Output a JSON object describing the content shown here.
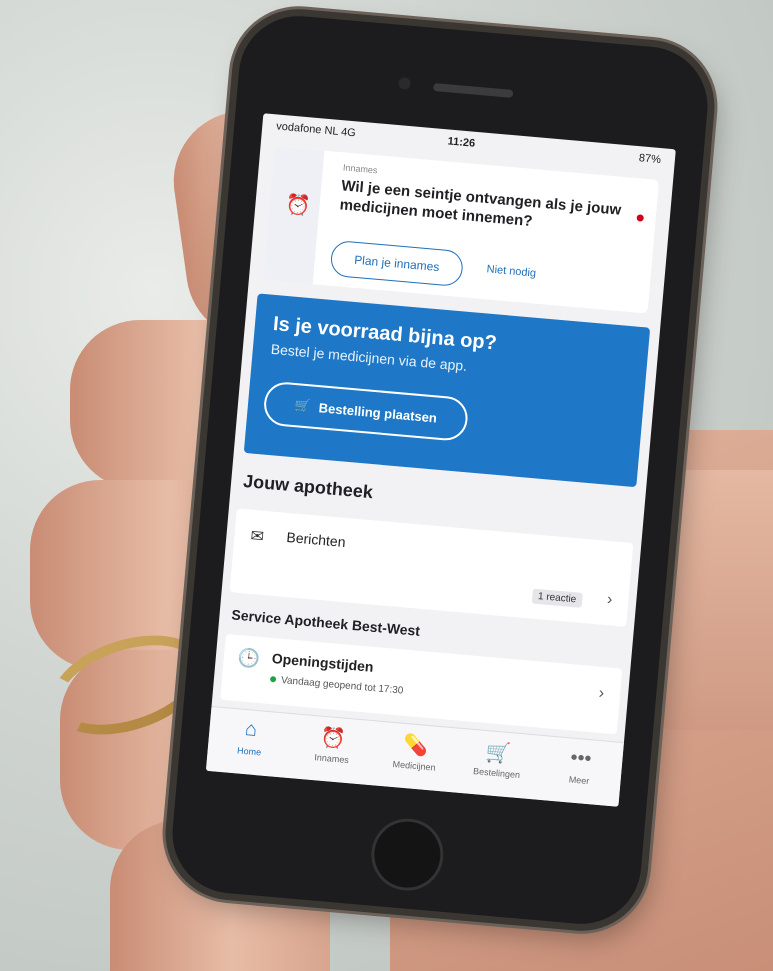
{
  "status_bar": {
    "carrier": "vodafone NL 4G",
    "time": "11:26",
    "battery": "87%"
  },
  "reminder": {
    "kicker": "Innames",
    "question": "Wil je een seintje ontvangen als je jouw medicijnen moet innemen?",
    "plan_button": "Plan je innames",
    "skip_link": "Niet nodig"
  },
  "promo": {
    "title": "Is je voorraad bijna op?",
    "subtitle": "Bestel je medicijnen via de app.",
    "order_button": "Bestelling plaatsen"
  },
  "section": {
    "title": "Jouw apotheek"
  },
  "messages": {
    "label": "Berichten",
    "badge": "1 reactie"
  },
  "pharmacy": {
    "name": "Service Apotheek Best-West"
  },
  "hours": {
    "label": "Openingstijden",
    "status": "Vandaag geopend tot 17:30"
  },
  "tabs": [
    {
      "label": "Home",
      "icon": "home-icon"
    },
    {
      "label": "Innames",
      "icon": "alarm-clock-icon"
    },
    {
      "label": "Medicijnen",
      "icon": "pills-icon"
    },
    {
      "label": "Bestelingen",
      "icon": "cart-icon"
    },
    {
      "label": "Meer",
      "icon": "more-icon"
    }
  ],
  "colors": {
    "brand_blue": "#1e78c7",
    "badge_red": "#d0021b",
    "open_green": "#1aa34a"
  }
}
